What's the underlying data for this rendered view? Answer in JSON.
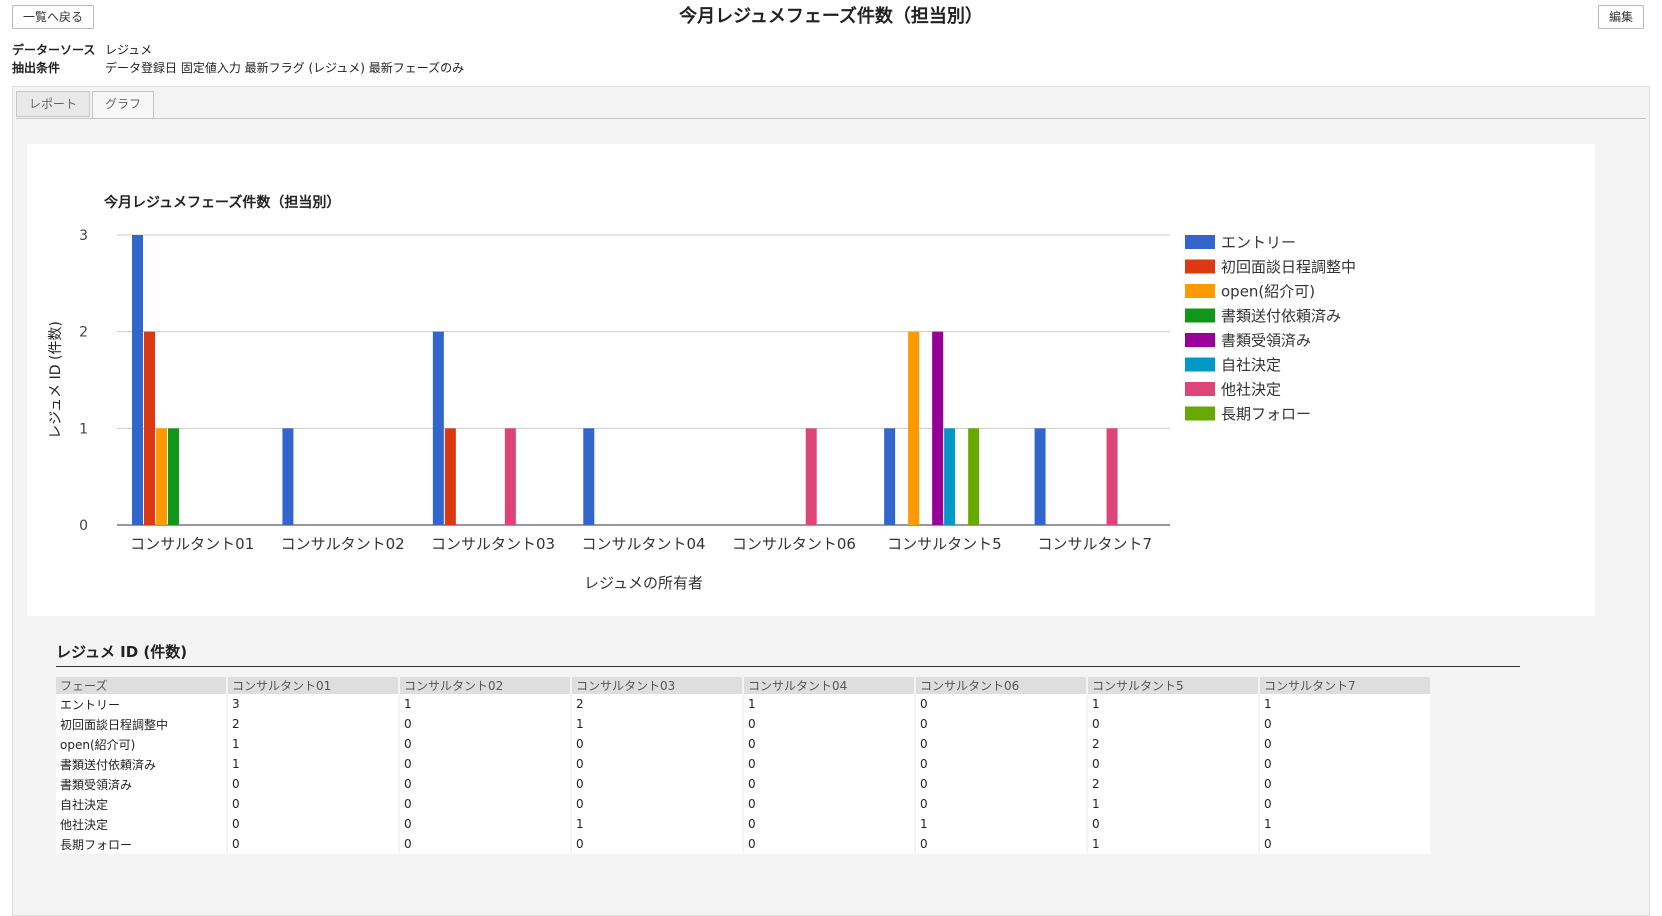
{
  "header": {
    "back_label": "一覧へ戻る",
    "title": "今月レジュメフェーズ件数（担当別）",
    "edit_label": "編集"
  },
  "meta": {
    "source_label": "データーソース",
    "source_value": "レジュメ",
    "condition_label": "抽出条件",
    "condition_value": "データ登録日 固定値入力 最新フラグ (レジュメ) 最新フェーズのみ"
  },
  "tabs": [
    {
      "label": "レポート",
      "active": false
    },
    {
      "label": "グラフ",
      "active": true
    }
  ],
  "chart_data": {
    "type": "bar",
    "title": "今月レジュメフェーズ件数（担当別）",
    "xlabel": "レジュメの所有者",
    "ylabel": "レジュメ ID (件数)",
    "ylim": [
      0,
      3
    ],
    "yticks": [
      0,
      1,
      2,
      3
    ],
    "grid": true,
    "legend_position": "right",
    "categories": [
      "コンサルタント01",
      "コンサルタント02",
      "コンサルタント03",
      "コンサルタント04",
      "コンサルタント06",
      "コンサルタント5",
      "コンサルタント7"
    ],
    "series": [
      {
        "name": "エントリー",
        "color": "#3366cc",
        "values": [
          3,
          1,
          2,
          1,
          0,
          1,
          1
        ]
      },
      {
        "name": "初回面談日程調整中",
        "color": "#dc3912",
        "values": [
          2,
          0,
          1,
          0,
          0,
          0,
          0
        ]
      },
      {
        "name": "open(紹介可)",
        "color": "#ff9900",
        "values": [
          1,
          0,
          0,
          0,
          0,
          2,
          0
        ]
      },
      {
        "name": "書類送付依頼済み",
        "color": "#109618",
        "values": [
          1,
          0,
          0,
          0,
          0,
          0,
          0
        ]
      },
      {
        "name": "書類受領済み",
        "color": "#990099",
        "values": [
          0,
          0,
          0,
          0,
          0,
          2,
          0
        ]
      },
      {
        "name": "自社決定",
        "color": "#0099c6",
        "values": [
          0,
          0,
          0,
          0,
          0,
          1,
          0
        ]
      },
      {
        "name": "他社決定",
        "color": "#dd4477",
        "values": [
          0,
          0,
          1,
          0,
          1,
          0,
          1
        ]
      },
      {
        "name": "長期フォロー",
        "color": "#66aa00",
        "values": [
          0,
          0,
          0,
          0,
          0,
          1,
          0
        ]
      }
    ]
  },
  "table": {
    "title": "レジュメ ID (件数)",
    "header_first": "フェーズ"
  }
}
